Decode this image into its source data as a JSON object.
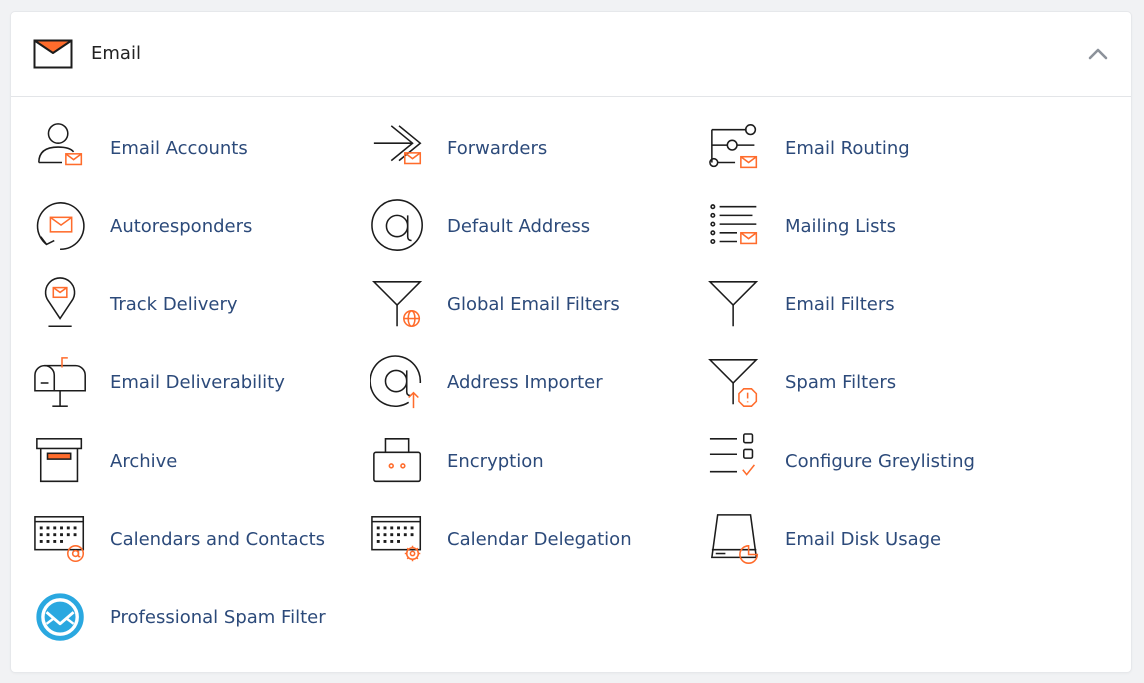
{
  "section": {
    "title": "Email",
    "header_icon": "envelope-icon",
    "toggle_icon": "chevron-up-icon"
  },
  "colors": {
    "accent": "#ff6c2c",
    "link": "#2c4a7a",
    "icon_stroke": "#1c1c1c",
    "spam_blue": "#2aa8e0"
  },
  "items": [
    {
      "label": "Email Accounts",
      "icon": "user-mail-icon"
    },
    {
      "label": "Forwarders",
      "icon": "forward-arrows-icon"
    },
    {
      "label": "Email Routing",
      "icon": "routing-switch-icon"
    },
    {
      "label": "Autoresponders",
      "icon": "auto-reply-icon"
    },
    {
      "label": "Default Address",
      "icon": "at-sign-icon"
    },
    {
      "label": "Mailing Lists",
      "icon": "list-mail-icon"
    },
    {
      "label": "Track Delivery",
      "icon": "map-pin-mail-icon"
    },
    {
      "label": "Global Email Filters",
      "icon": "filter-globe-icon"
    },
    {
      "label": "Email Filters",
      "icon": "filter-funnel-icon"
    },
    {
      "label": "Email Deliverability",
      "icon": "mailbox-icon"
    },
    {
      "label": "Address Importer",
      "icon": "at-import-icon"
    },
    {
      "label": "Spam Filters",
      "icon": "filter-warning-icon"
    },
    {
      "label": "Archive",
      "icon": "archive-box-icon"
    },
    {
      "label": "Encryption",
      "icon": "lock-icon"
    },
    {
      "label": "Configure Greylisting",
      "icon": "checklist-icon"
    },
    {
      "label": "Calendars and Contacts",
      "icon": "calendar-at-icon"
    },
    {
      "label": "Calendar Delegation",
      "icon": "calendar-gear-icon"
    },
    {
      "label": "Email Disk Usage",
      "icon": "disk-chart-icon"
    },
    {
      "label": "Professional Spam Filter",
      "icon": "spam-experts-icon"
    }
  ]
}
